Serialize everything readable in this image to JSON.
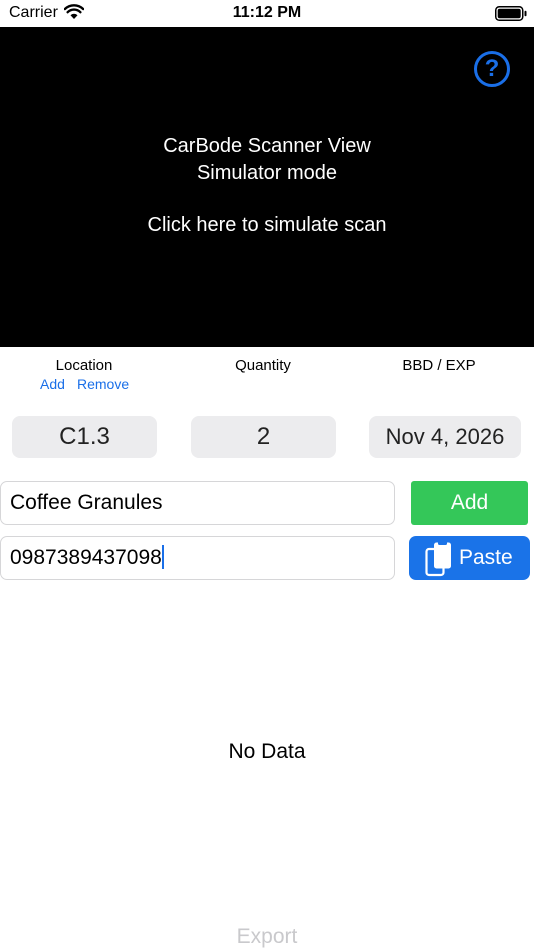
{
  "status_bar": {
    "carrier": "Carrier",
    "time": "11:12 PM"
  },
  "scanner": {
    "line1": "CarBode Scanner View",
    "line2": "Simulator mode",
    "line3": "Click here to simulate scan",
    "help_symbol": "?"
  },
  "location": {
    "label": "Location",
    "add_link": "Add",
    "remove_link": "Remove",
    "value": "C1.3"
  },
  "quantity": {
    "label": "Quantity",
    "value": "2"
  },
  "expiry": {
    "label": "BBD / EXP",
    "value": "Nov 4, 2026"
  },
  "product": {
    "name_value": "Coffee Granules",
    "barcode_value": "0987389437098"
  },
  "buttons": {
    "add_label": "Add",
    "paste_label": "Paste",
    "export_label": "Export"
  },
  "list": {
    "empty_text": "No Data"
  },
  "colors": {
    "accent_blue": "#1a6fe8",
    "add_green": "#34c759",
    "paste_blue": "#1a73e8",
    "disabled_gray": "#c9c9cc"
  }
}
